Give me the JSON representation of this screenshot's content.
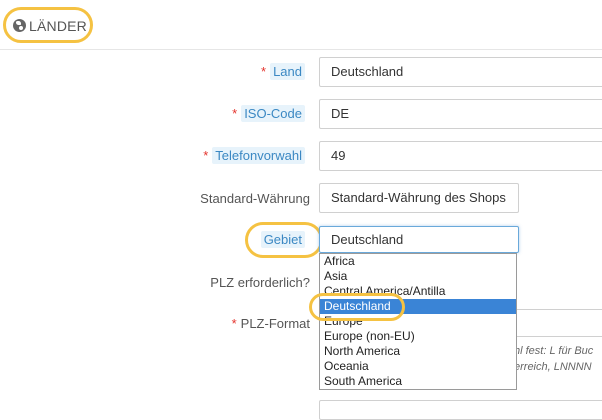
{
  "panel": {
    "title": "LÄNDER",
    "icon": "globe-icon"
  },
  "form": {
    "land": {
      "label": "Land",
      "value": "Deutschland",
      "required": "*"
    },
    "iso": {
      "label": "ISO-Code",
      "value": "DE",
      "required": "*"
    },
    "phone": {
      "label": "Telefonvorwahl",
      "value": "49",
      "required": "*"
    },
    "currency": {
      "label": "Standard-Währung",
      "value": "Standard-Währung des Shops"
    },
    "zone": {
      "label": "Gebiet",
      "value": "Deutschland"
    },
    "zip_required": {
      "label": "PLZ erforderlich?"
    },
    "zip_format": {
      "label": "PLZ-Format",
      "required": "*"
    }
  },
  "zone_dropdown": {
    "options": [
      "Africa",
      "Asia",
      "Central America/Antilla",
      "Deutschland",
      "Europe",
      "Europe (non-EU)",
      "North America",
      "Oceania",
      "South America"
    ],
    "selected": "Deutschland"
  },
  "partially_hidden": {
    "hint_line1": "hl fest: L für Buc",
    "hint_line2": "erreich, LNNNN"
  },
  "highlight_color": "#f5c242"
}
